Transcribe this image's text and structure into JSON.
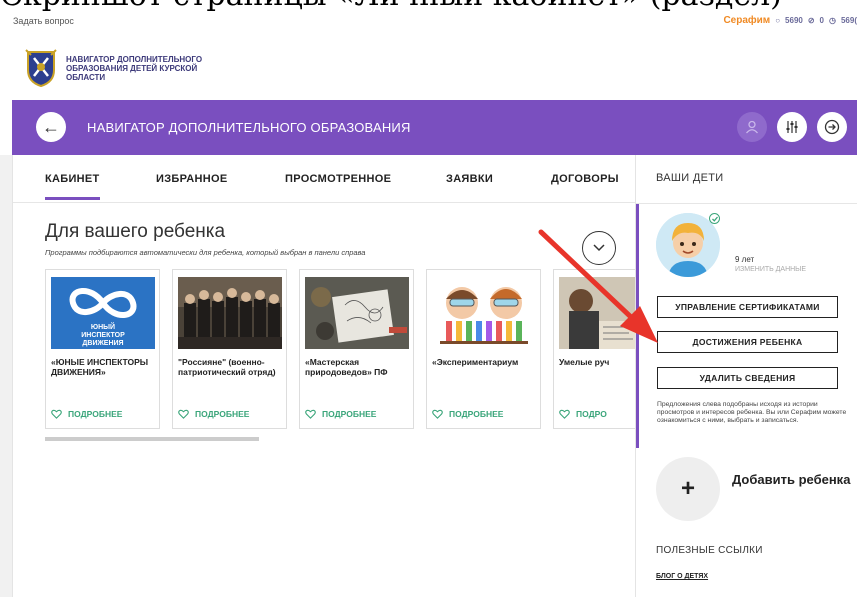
{
  "topbar": {
    "ask_label": "Задать вопрос",
    "user_name": "Серафим",
    "stat1": "5690",
    "stat2": "0",
    "stat3": "569("
  },
  "brand": {
    "name": "НАВИГАТОР ДОПОЛНИТЕЛЬНОГО ОБРАЗОВАНИЯ ДЕТЕЙ КУРСКОЙ ОБЛАСТИ"
  },
  "header": {
    "title": "НАВИГАТОР ДОПОЛНИТЕЛЬНОГО ОБРАЗОВАНИЯ",
    "back_icon": "arrow-left-icon",
    "user_icon": "user-icon",
    "filter_icon": "sliders-icon",
    "logout_icon": "arrow-circle-right-icon"
  },
  "tabs": [
    {
      "label": "КАБИНЕТ",
      "active": true
    },
    {
      "label": "ИЗБРАННОЕ",
      "active": false
    },
    {
      "label": "ПРОСМОТРЕННОЕ",
      "active": false
    },
    {
      "label": "ЗАЯВКИ",
      "active": false
    },
    {
      "label": "ДОГОВОРЫ",
      "active": false
    }
  ],
  "recommend": {
    "title": "Для вашего ребенка",
    "subtitle": "Программы подбираются автоматически для ребенка, который выбран в панели справа",
    "more_label": "ПОДРОБНЕЕ",
    "cards": [
      {
        "title": "«ЮНЫЕ ИНСПЕКТОРЫ ДВИЖЕНИЯ»",
        "logo_text": "ЮНЫЙ ИНСПЕКТОР ДВИЖЕНИЯ"
      },
      {
        "title": "\"Россияне\" (военно-патриотический отряд)"
      },
      {
        "title": "«Мастерская природоведов» ПФ"
      },
      {
        "title": "«Экспериментариум"
      },
      {
        "title": "Умелые руч"
      }
    ],
    "more_partial": "ПОДРО"
  },
  "children_panel": {
    "title": "ВАШИ ДЕТИ",
    "age": "9 лет",
    "edit_label": "ИЗМЕНИТЬ ДАННЫЕ",
    "btn_certificates": "УПРАВЛЕНИЕ СЕРТИФИКАТАМИ",
    "btn_achievements": "ДОСТИЖЕНИЯ РЕБЕНКА",
    "btn_delete": "УДАЛИТЬ СВЕДЕНИЯ",
    "note": "Предложения слева подобраны исходя из истории просмотров и интересов ребенка. Вы или Серафим можете ознакомиться с ними, выбрать и записаться.",
    "add_label": "Добавить ребенка",
    "useful_title": "ПОЛЕЗНЫЕ ССЫЛКИ",
    "blog_link": "БЛОГ О ДЕТЯХ"
  },
  "colors": {
    "accent": "#7a4fbf",
    "green": "#3aa57a",
    "orange": "#f08a24",
    "arrow": "#e8342a"
  }
}
